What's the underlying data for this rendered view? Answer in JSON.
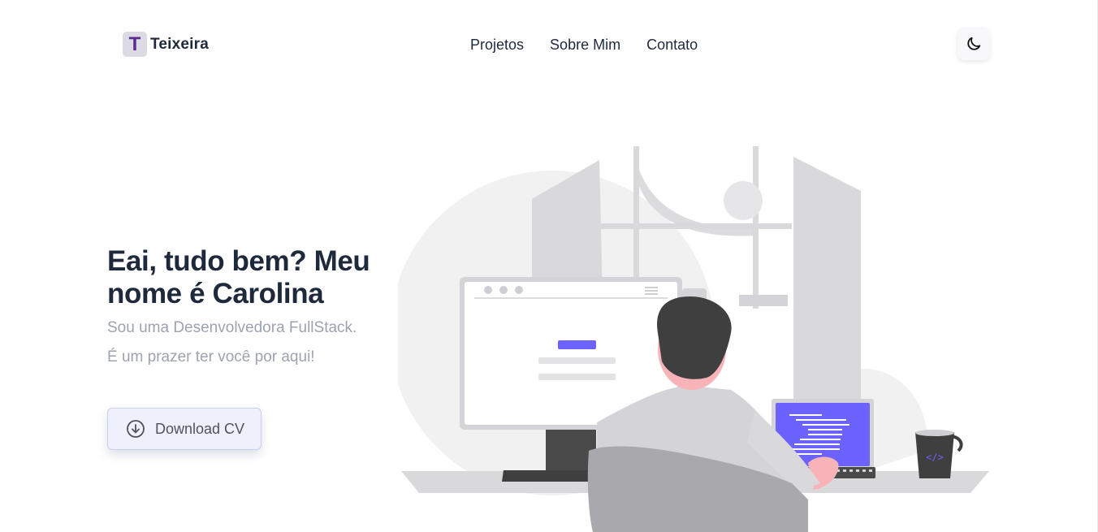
{
  "brand": {
    "logo_letter": "T",
    "name": "Teixeira",
    "logo_color": "#5b2a8e"
  },
  "nav": {
    "items": [
      "Projetos",
      "Sobre Mim",
      "Contato"
    ]
  },
  "theme_toggle": {
    "icon": "moon-icon"
  },
  "hero": {
    "title": "Eai, tudo bem? Meu nome é Carolina",
    "subtitle_1": "Sou uma Desenvolvedora FullStack.",
    "subtitle_2": "É um prazer ter você por aqui!",
    "cv_button": {
      "label": "Download CV",
      "icon": "download-circle-icon"
    }
  },
  "illustration": {
    "subject": "developer working at desk",
    "accent_color": "#6c63ff",
    "mug_text": "</>"
  },
  "colors": {
    "text": "#1e293b",
    "muted": "#9ca3af",
    "accent": "#6c63ff"
  }
}
